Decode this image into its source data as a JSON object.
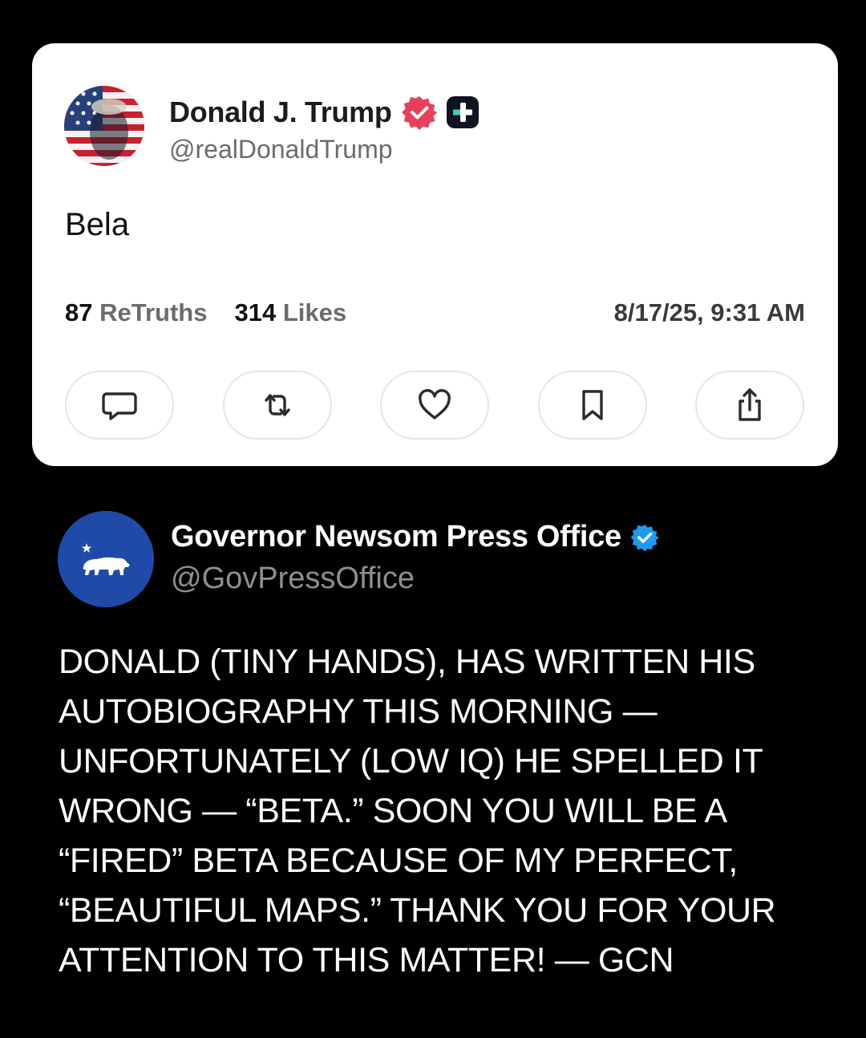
{
  "truth_post": {
    "author_name": "Donald J. Trump",
    "author_handle": "@realDonaldTrump",
    "text": "Bela",
    "retruths_count": "87",
    "retruths_label": "ReTruths",
    "likes_count": "314",
    "likes_label": "Likes",
    "timestamp": "8/17/25, 9:31 AM",
    "actions": [
      {
        "icon": "comment-icon"
      },
      {
        "icon": "retruth-icon"
      },
      {
        "icon": "heart-icon"
      },
      {
        "icon": "bookmark-icon"
      },
      {
        "icon": "share-icon"
      }
    ],
    "colors": {
      "verified_badge": "#e8405c",
      "card_background": "#ffffff"
    }
  },
  "reply_post": {
    "author_name": "Governor Newsom Press Office",
    "author_handle": "@GovPressOffice",
    "text": "DONALD (TINY HANDS), HAS WRITTEN HIS AUTOBIOGRAPHY THIS MORNING — UNFORTUNATELY (LOW IQ) HE SPELLED IT WRONG — “BETA.” SOON YOU WILL BE A “FIRED” BETA BECAUSE OF MY PERFECT, “BEAUTIFUL MAPS.” THANK YOU FOR YOUR ATTENTION TO THIS MATTER! — GCN",
    "colors": {
      "verified_badge": "#1d9bf0",
      "avatar_background": "#1f4aa8"
    }
  }
}
